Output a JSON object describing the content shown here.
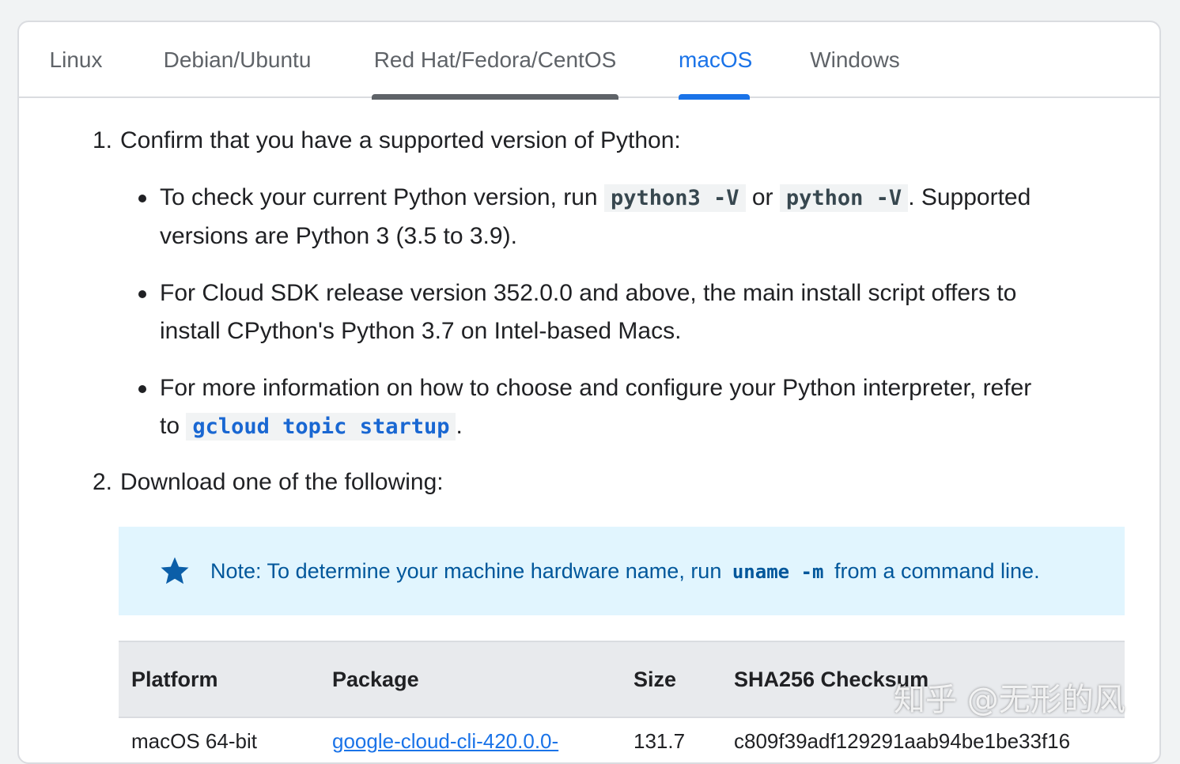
{
  "tabs": [
    {
      "label": "Linux"
    },
    {
      "label": "Debian/Ubuntu"
    },
    {
      "label": "Red Hat/Fedora/CentOS"
    },
    {
      "label": "macOS"
    },
    {
      "label": "Windows"
    }
  ],
  "active_tab": "macOS",
  "steps": [
    {
      "number": "1.",
      "text": "Confirm that you have a supported version of Python:"
    },
    {
      "number": "2.",
      "text": "Download one of the following:"
    }
  ],
  "bullets": {
    "b1": {
      "prefix": "To check your current Python version, run",
      "code1": "python3 -V",
      "mid": "or",
      "code2": "python -V",
      "suffix": ". Supported",
      "line2": "versions are Python 3 (3.5 to 3.9)."
    },
    "b2": {
      "line1": "For Cloud SDK release version 352.0.0 and above, the main install script offers to",
      "line2": "install CPython's Python 3.7 on Intel-based Macs."
    },
    "b3": {
      "line1": "For more information on how to choose and configure your Python interpreter, refer",
      "line2_prefix": "to",
      "link": "gcloud topic startup",
      "line2_suffix": "."
    }
  },
  "note": {
    "icon": "star-icon",
    "prefix": "Note: To determine your machine hardware name, run",
    "code": "uname -m",
    "suffix": "from a command line."
  },
  "table": {
    "headers": [
      "Platform",
      "Package",
      "Size",
      "SHA256 Checksum"
    ],
    "rows": [
      {
        "platform": "macOS 64-bit",
        "package": "google-cloud-cli-420.0.0-",
        "size": "131.7",
        "checksum": "c809f39adf129291aab94be1be33f16"
      }
    ]
  },
  "watermark": "知乎 @无形的风",
  "colors": {
    "accent": "#1a73e8",
    "note_bg": "#e1f5fe",
    "note_text": "#01579b",
    "header_bg": "#e8eaed"
  }
}
